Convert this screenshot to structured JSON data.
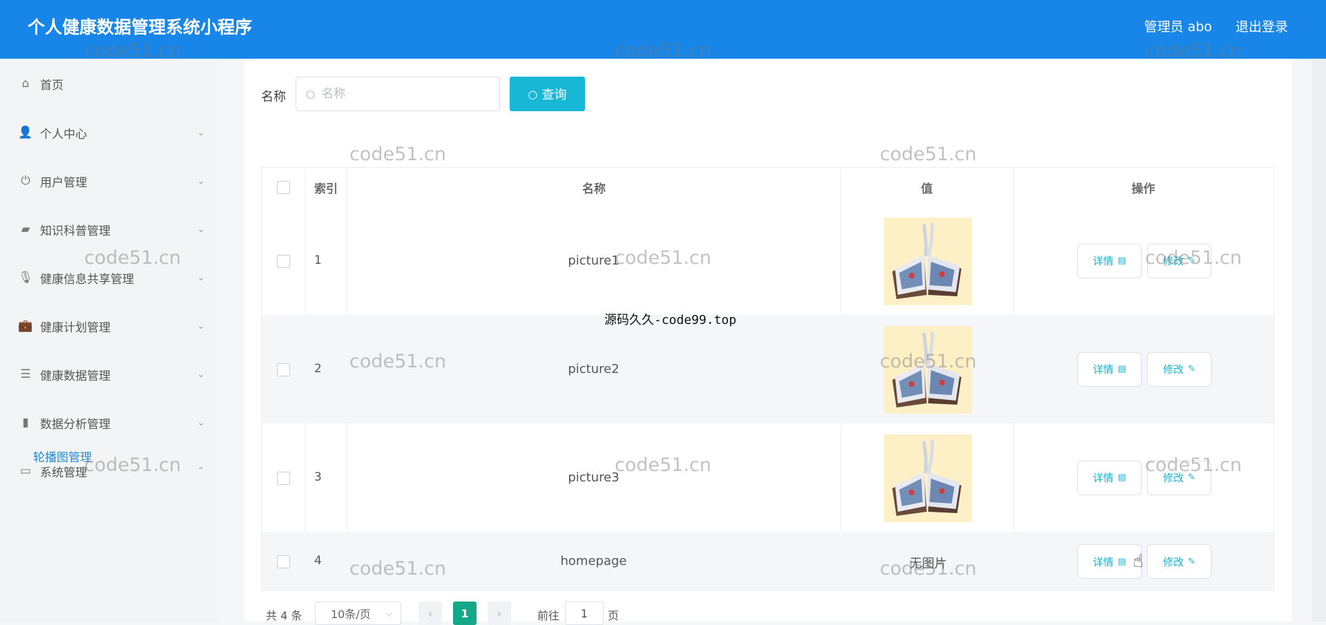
{
  "header": {
    "app_title": "个人健康数据管理系统小程序",
    "user_label": "管理员 abo",
    "logout": "退出登录"
  },
  "sidebar": {
    "items": [
      {
        "label": "首页",
        "icon": "home-icon",
        "glyph": "⌂"
      },
      {
        "label": "个人中心",
        "icon": "user-icon",
        "glyph": "👤"
      },
      {
        "label": "用户管理",
        "icon": "power-icon",
        "glyph": "⏻"
      },
      {
        "label": "知识科普管理",
        "icon": "wallet-icon",
        "glyph": "▰"
      },
      {
        "label": "健康信息共享管理",
        "icon": "mic-icon",
        "glyph": "🎙"
      },
      {
        "label": "健康计划管理",
        "icon": "briefcase-icon",
        "glyph": "💼"
      },
      {
        "label": "健康数据管理",
        "icon": "list-icon",
        "glyph": "☰"
      },
      {
        "label": "数据分析管理",
        "icon": "bar-chart-icon",
        "glyph": "▮"
      },
      {
        "label": "系统管理",
        "icon": "window-icon",
        "glyph": "▭"
      }
    ],
    "submenu_active": "轮播图管理"
  },
  "search": {
    "label": "名称",
    "placeholder": "名称",
    "button": "查询"
  },
  "table": {
    "headers": {
      "index": "索引",
      "name": "名称",
      "value": "值",
      "actions": "操作"
    },
    "rows": [
      {
        "index": "1",
        "name": "picture1",
        "value_image": true
      },
      {
        "index": "2",
        "name": "picture2",
        "value_image": true
      },
      {
        "index": "3",
        "name": "picture3",
        "value_image": true
      },
      {
        "index": "4",
        "name": "homepage",
        "value_image": false,
        "value_text": "无图片"
      }
    ],
    "detail_label": "详情",
    "edit_label": "修改"
  },
  "pagination": {
    "total": "共 4 条",
    "page_size": "10条/页",
    "current_page": "1",
    "goto_prefix": "前往",
    "goto_value": "1",
    "goto_suffix": "页"
  },
  "watermarks": {
    "site": "code51.cn",
    "center": "源码久久-code99.top"
  },
  "colors": {
    "header_bg": "#1786e8",
    "accent": "#19b7d6",
    "pager_active": "#14a888",
    "submenu_active": "#1f8ad8"
  }
}
